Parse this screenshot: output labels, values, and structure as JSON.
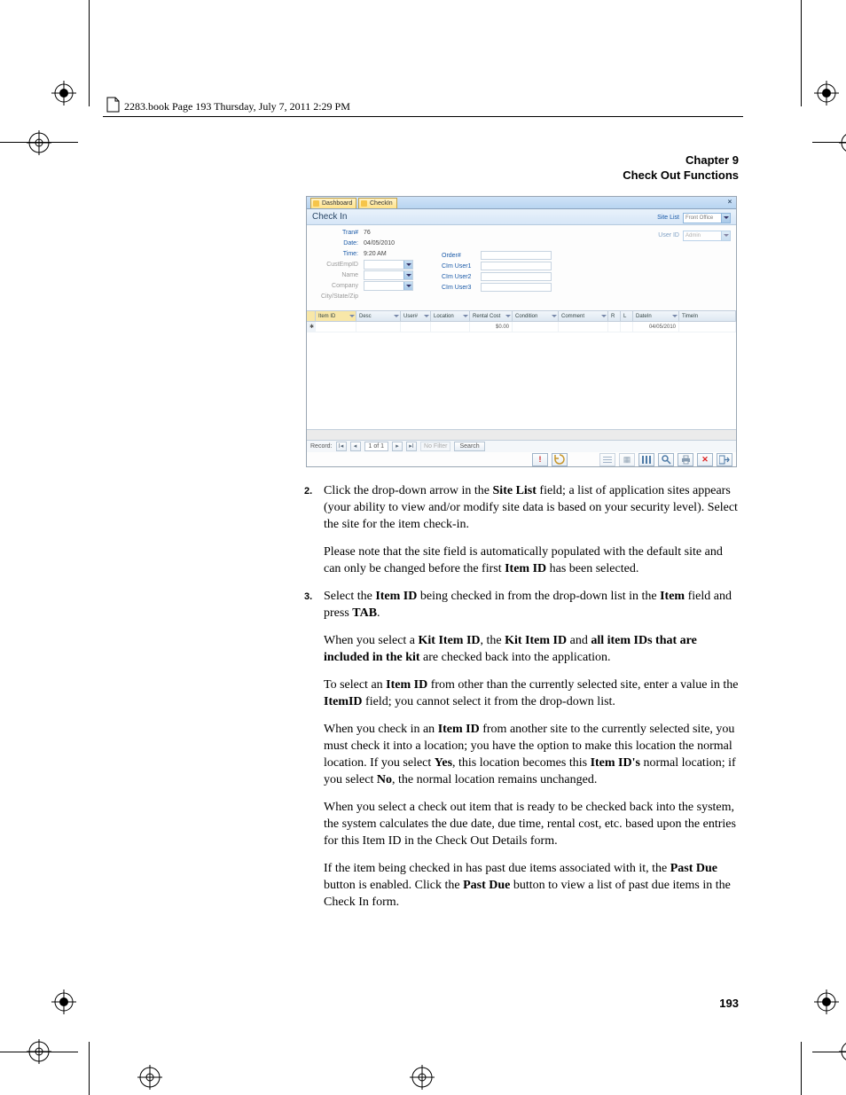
{
  "book_header": "2283.book  Page 193  Thursday, July 7, 2011  2:29 PM",
  "chapter_line1": "Chapter 9",
  "chapter_line2": "Check Out Functions",
  "page_number": "193",
  "app": {
    "tabs": {
      "t1": "Dashboard",
      "t2": "CheckIn"
    },
    "title": "Check In",
    "site_list_label": "Site List",
    "user_id_label": "User ID",
    "site_list_value": "Front Office",
    "user_id_value": "Admin",
    "left_fields": {
      "tran_label": "Tran#",
      "tran_value": "76",
      "date_label": "Date:",
      "date_value": "04/05/2010",
      "time_label": "Time:",
      "time_value": "9:20 AM",
      "cust_label": "CustEmpID",
      "name_label": "Name",
      "company_label": "Company",
      "csz_label": "City/State/Zip"
    },
    "mid_fields": {
      "order_label": "Order#",
      "u1": "CIm User1",
      "u2": "CIm User2",
      "u3": "CIm User3"
    },
    "grid": {
      "headers": [
        "",
        "Item ID",
        "Desc",
        "User#",
        "Location",
        "Rental Cost",
        "Condition",
        "Comment",
        "R",
        "L",
        "DateIn",
        "TimeIn"
      ],
      "row1_cost": "$0.00",
      "row1_date": "04/05/2010"
    },
    "footer": {
      "record_text": "Record:",
      "pos": "1 of 1",
      "nofilter": "No Filter",
      "search": "Search"
    }
  },
  "steps": {
    "s2": {
      "num": "2.",
      "p1a": "Click the drop-down arrow in the ",
      "p1b": "Site List",
      "p1c": " field; a list of application sites appears (your ability to view and/or modify site data is based on your security level). Select the site for the item check-in.",
      "p2a": "Please note that the site field is automatically populated with the default site and can only be changed before the first ",
      "p2b": "Item ID",
      "p2c": " has been selected."
    },
    "s3": {
      "num": "3.",
      "p1a": "Select the ",
      "p1b": "Item ID",
      "p1c": " being checked in from the drop-down list in the ",
      "p1d": "Item",
      "p1e": " field and press ",
      "p1f": "TAB",
      "p1g": ".",
      "p2a": "When you select a ",
      "p2b": "Kit Item ID",
      "p2c": ", the ",
      "p2d": "Kit Item ID",
      "p2e": " and ",
      "p2f": "all item IDs that are included in the kit",
      "p2g": " are checked back into the application.",
      "p3a": "To select an ",
      "p3b": "Item ID",
      "p3c": " from other than the currently selected site, enter a value in the ",
      "p3d": "ItemID",
      "p3e": " field; you cannot select it from the drop-down list.",
      "p4a": "When you check in an ",
      "p4b": "Item ID",
      "p4c": " from another site to the currently selected site, you must check it into a location; you have the option to make this location the normal location. If you select ",
      "p4d": "Yes",
      "p4e": ", this location becomes this ",
      "p4f": "Item ID's",
      "p4g": " normal location; if you select ",
      "p4h": "No",
      "p4i": ", the normal location remains unchanged.",
      "p5": "When you select a check out item that is ready to be checked back into the system, the system calculates the due date, due time, rental cost, etc. based upon the entries for this Item ID in the Check Out Details form.",
      "p6a": "If the item being checked in has past due items associated with it, the ",
      "p6b": "Past Due",
      "p6c": " button is enabled. Click the ",
      "p6d": "Past Due",
      "p6e": " button to view a list of past due items in the Check In form."
    }
  }
}
